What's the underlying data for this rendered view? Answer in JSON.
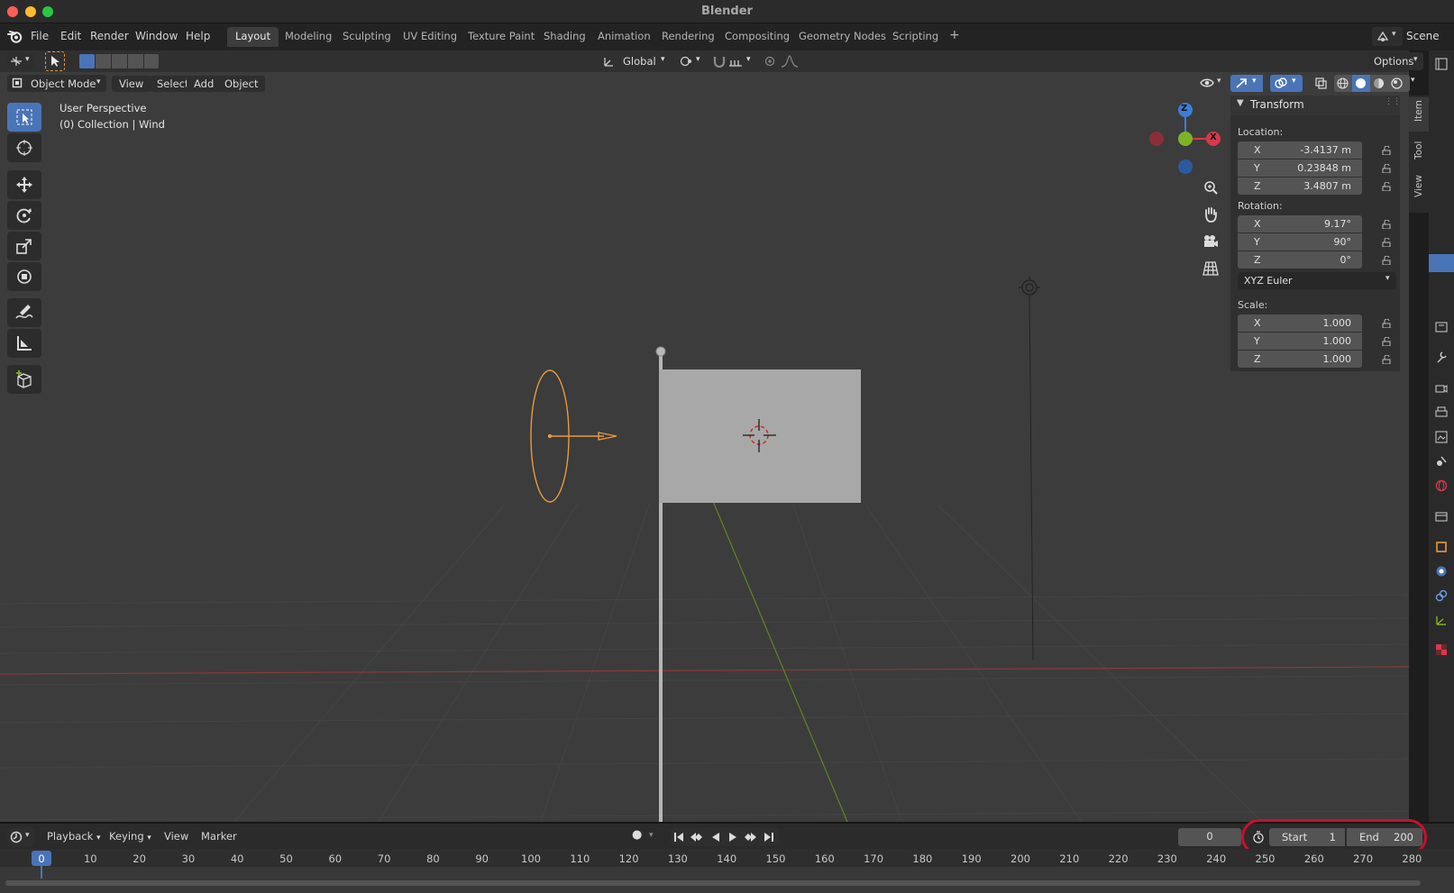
{
  "window": {
    "title": "Blender"
  },
  "menus": [
    "File",
    "Edit",
    "Render",
    "Window",
    "Help"
  ],
  "workspaces": {
    "tabs": [
      "Layout",
      "Modeling",
      "Sculpting",
      "UV Editing",
      "Texture Paint",
      "Shading",
      "Animation",
      "Rendering",
      "Compositing",
      "Geometry Nodes",
      "Scripting"
    ],
    "active": "Layout",
    "add_label": "+"
  },
  "scene": {
    "label": "Scene"
  },
  "header": {
    "orientation": "Global",
    "options_label": "Options"
  },
  "viewport": {
    "mode": "Object Mode",
    "menus": [
      "View",
      "Select",
      "Add",
      "Object"
    ],
    "perspective_label": "User Perspective",
    "collection_label": "(0) Collection | Wind",
    "gizmo": {
      "z": "Z",
      "y": "Y",
      "x": "X"
    }
  },
  "transform_panel": {
    "title": "Transform",
    "location_label": "Location:",
    "location": [
      {
        "axis": "X",
        "value": "-3.4137 m"
      },
      {
        "axis": "Y",
        "value": "0.23848 m"
      },
      {
        "axis": "Z",
        "value": "3.4807 m"
      }
    ],
    "rotation_label": "Rotation:",
    "rotation": [
      {
        "axis": "X",
        "value": "9.17°"
      },
      {
        "axis": "Y",
        "value": "90°"
      },
      {
        "axis": "Z",
        "value": "0°"
      }
    ],
    "rotation_mode": "XYZ Euler",
    "scale_label": "Scale:",
    "scale": [
      {
        "axis": "X",
        "value": "1.000"
      },
      {
        "axis": "Y",
        "value": "1.000"
      },
      {
        "axis": "Z",
        "value": "1.000"
      }
    ]
  },
  "sidebar_tabs": [
    "Item",
    "Tool",
    "View"
  ],
  "timeline": {
    "menus": [
      "Playback",
      "Keying",
      "View",
      "Marker"
    ],
    "current_frame": "0",
    "start_label": "Start",
    "start_value": "1",
    "end_label": "End",
    "end_value": "200",
    "ruler_ticks": [
      "0",
      "10",
      "20",
      "30",
      "40",
      "50",
      "60",
      "70",
      "80",
      "90",
      "100",
      "110",
      "120",
      "130",
      "140",
      "150",
      "160",
      "170",
      "180",
      "190",
      "200",
      "210",
      "220",
      "230",
      "240",
      "250",
      "260",
      "270",
      "280"
    ],
    "highlight_color": "#c8102e"
  },
  "colors": {
    "accent": "#4a74b8",
    "selection": "#e89a3c",
    "x_axis": "#d8384b",
    "y_axis": "#7fb327",
    "z_axis": "#3b7dd8"
  }
}
